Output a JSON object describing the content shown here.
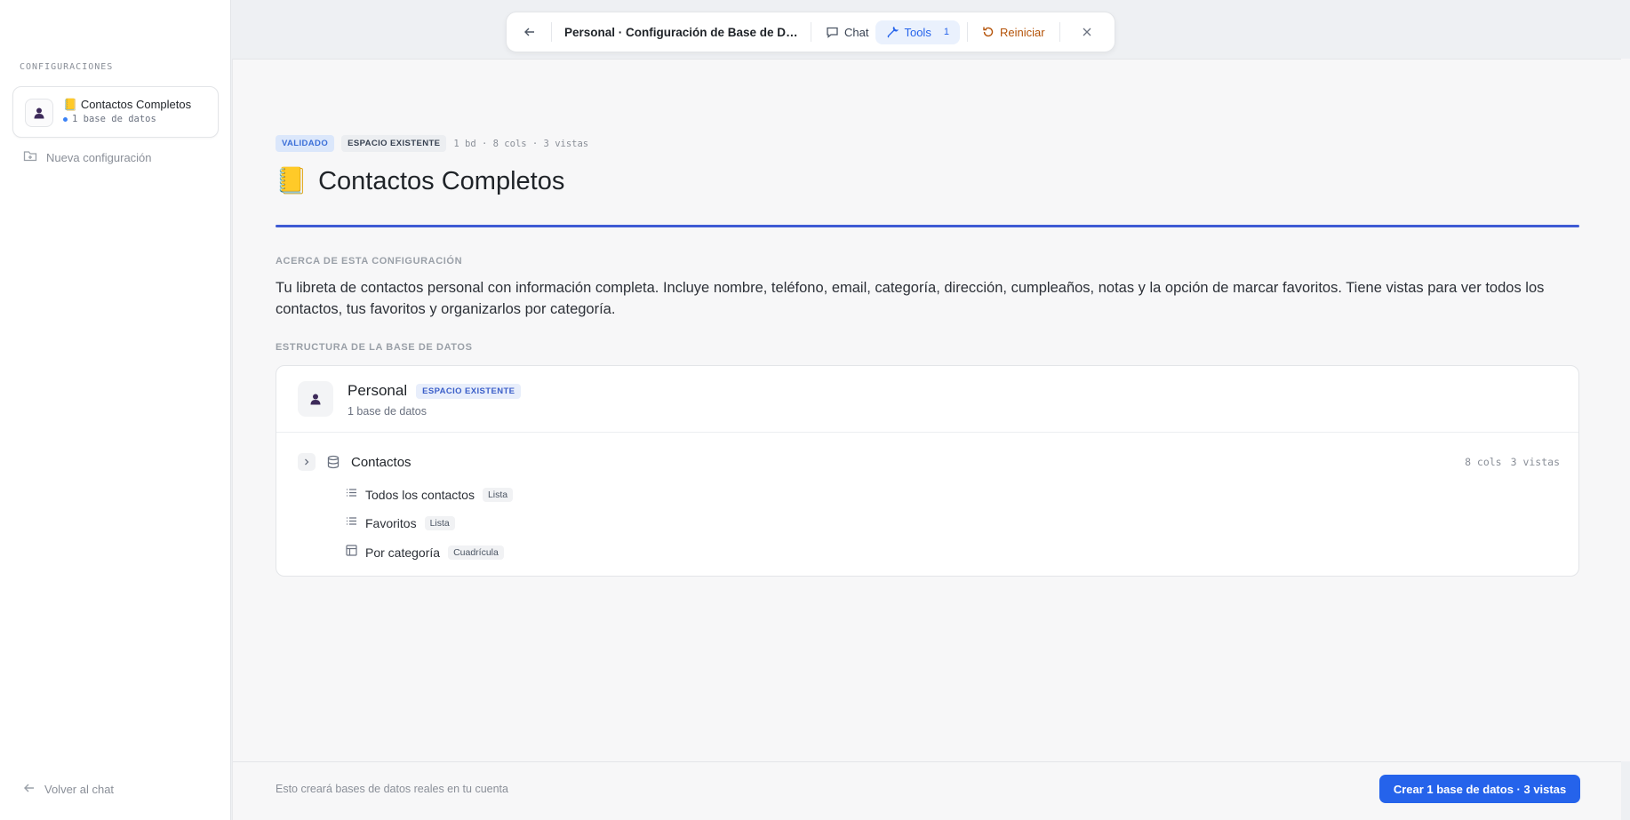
{
  "sidebar": {
    "section_label": "CONFIGURACIONES",
    "config": {
      "emoji": "📒",
      "title": "Contactos Completos",
      "subtitle": "1 base de datos"
    },
    "new_config_label": "Nueva configuración",
    "back_label": "Volver al chat"
  },
  "toolbar": {
    "title": "Personal · Configuración de Base de Da...",
    "chat_label": "Chat",
    "tools_label": "Tools",
    "tools_count": "1",
    "reset_label": "Reiniciar"
  },
  "main": {
    "badge_validated": "VALIDADO",
    "badge_space": "ESPACIO EXISTENTE",
    "meta": "1 bd · 8 cols · 3 vistas",
    "emoji": "📒",
    "title": "Contactos Completos",
    "about_label": "ACERCA DE ESTA CONFIGURACIÓN",
    "description": "Tu libreta de contactos personal con información completa. Incluye nombre, teléfono, email, categoría, dirección, cumpleaños, notas y la opción de marcar favoritos. Tiene vistas para ver todos los contactos, tus favoritos y organizarlos por categoría.",
    "structure_label": "ESTRUCTURA DE LA BASE DE DATOS",
    "workspace": {
      "name": "Personal",
      "badge": "ESPACIO EXISTENTE",
      "subtitle": "1 base de datos"
    },
    "database": {
      "name": "Contactos",
      "cols": "8 cols",
      "views_count": "3 vistas",
      "views": [
        {
          "name": "Todos los contactos",
          "type": "Lista",
          "icon": "list-icon"
        },
        {
          "name": "Favoritos",
          "type": "Lista",
          "icon": "list-icon"
        },
        {
          "name": "Por categoría",
          "type": "Cuadrícula",
          "icon": "grid-icon"
        }
      ]
    }
  },
  "footer": {
    "note": "Esto creará bases de datos reales en tu cuenta",
    "create_label": "Crear 1 base de datos · 3 vistas"
  },
  "colors": {
    "accent": "#2563eb",
    "accent_line": "#3f5bd4",
    "reset": "#b45309"
  }
}
